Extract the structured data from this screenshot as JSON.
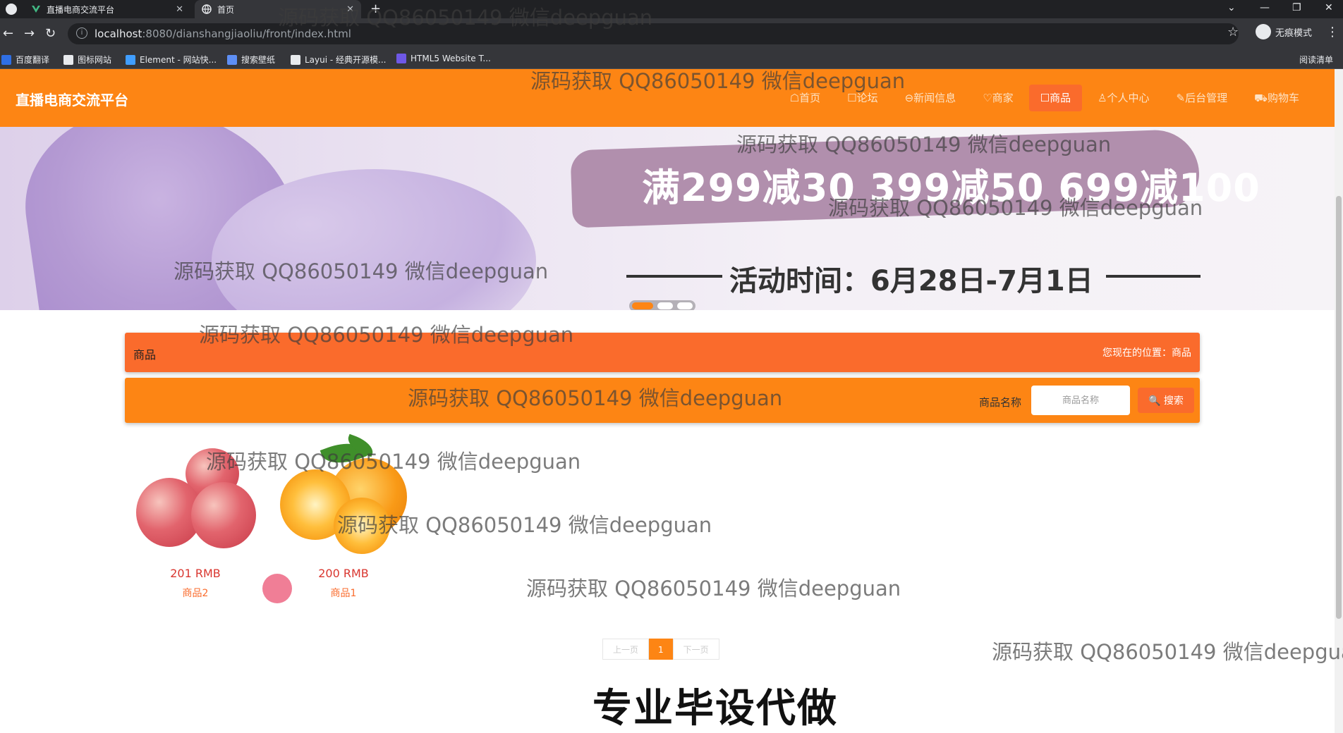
{
  "browser": {
    "tabs": [
      {
        "title": "直播电商交流平台",
        "active": false
      },
      {
        "title": "首页",
        "active": true
      }
    ],
    "new_tab": "+",
    "url_host": "localhost",
    "url_path": ":8080/dianshangjiaoliu/front/index.html",
    "profile": "无痕模式",
    "bookmarks": [
      "百度翻译",
      "图标网站",
      "Element - 网站快...",
      "搜索壁纸",
      "Layui - 经典开源模...",
      "HTML5 Website T..."
    ],
    "reading_list": "阅读清单"
  },
  "site": {
    "brand": "直播电商交流平台",
    "nav": [
      {
        "label": "☖首页",
        "active": false
      },
      {
        "label": "☐论坛",
        "active": false
      },
      {
        "label": "⊖新闻信息",
        "active": false
      },
      {
        "label": "♡商家",
        "active": false
      },
      {
        "label": "☐商品",
        "active": true
      },
      {
        "label": "♙个人中心",
        "active": false
      },
      {
        "label": "✎后台管理",
        "active": false
      },
      {
        "label": "⛟购物车",
        "active": false
      }
    ]
  },
  "banner": {
    "promo": "满299减30  399减50  699减100",
    "time": "活动时间：6月28日-7月1日"
  },
  "section": {
    "title": "商品",
    "breadcrumb": "您现在的位置：商品"
  },
  "search": {
    "label": "商品名称",
    "placeholder": "商品名称",
    "button": "🔍 搜索"
  },
  "goods": [
    {
      "price": "201 RMB",
      "name": "商品2"
    },
    {
      "price": "200 RMB",
      "name": "商品1"
    }
  ],
  "pager": {
    "prev": "上一页",
    "current": "1",
    "next": "下一页"
  },
  "caption": "专业毕设代做",
  "watermark": "源码获取 QQ86050149 微信deepguan",
  "colors": {
    "header": "#fd8514",
    "accent": "#fa6b2c",
    "price": "#d9362f"
  }
}
